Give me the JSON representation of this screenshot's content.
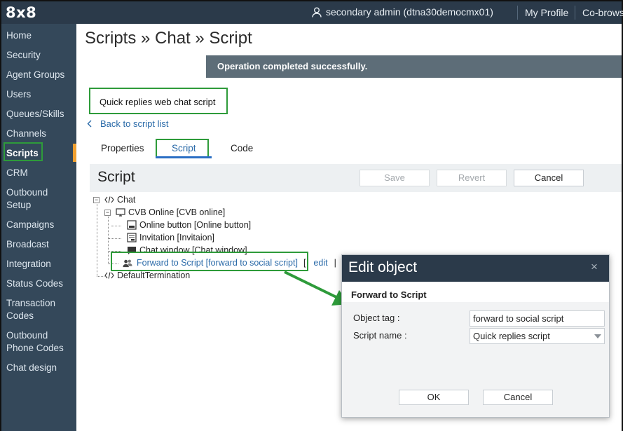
{
  "topbar": {
    "logo": "8x8",
    "user": "secondary admin (dtna30democmx01)",
    "my_profile": "My Profile",
    "cobrowse": "Co-brows"
  },
  "sidebar": {
    "items": [
      {
        "label": "Home"
      },
      {
        "label": "Security"
      },
      {
        "label": "Agent Groups"
      },
      {
        "label": "Users"
      },
      {
        "label": "Queues/Skills"
      },
      {
        "label": "Channels"
      },
      {
        "label": "Scripts",
        "active": true
      },
      {
        "label": "CRM"
      },
      {
        "label": "Outbound"
      },
      {
        "label": "Setup"
      },
      {
        "label": "Campaigns"
      },
      {
        "label": "Broadcast"
      },
      {
        "label": "Integration"
      },
      {
        "label": "Status Codes"
      },
      {
        "label": "Transaction"
      },
      {
        "label": "Codes"
      },
      {
        "label": "Outbound"
      },
      {
        "label": "Phone Codes"
      },
      {
        "label": "Chat design"
      }
    ]
  },
  "page": {
    "title": "Scripts » Chat » Script",
    "toast": "Operation completed successfully.",
    "script_name": "Quick replies web chat script",
    "back_link": "Back to script list",
    "tabs": [
      "Properties",
      "Script",
      "Code"
    ],
    "active_tab": "Script"
  },
  "script_panel": {
    "title": "Script",
    "save": "Save",
    "revert": "Revert",
    "cancel": "Cancel"
  },
  "tree": {
    "chat": "Chat",
    "cvb": "CVB Online [CVB online]",
    "online_button": "Online button [Online button]",
    "invitation": "Invitation [Invitaion]",
    "chat_window": "Chat window [Chat window]",
    "forward": "Forward to Script [forward to social script]",
    "bracket_open": "[",
    "edit": "edit",
    "pipe": "|",
    "default_termination": "DefaultTermination"
  },
  "dialog": {
    "title": "Edit object",
    "close": "×",
    "subtitle": "Forward to Script",
    "object_tag_label": "Object tag :",
    "object_tag_value": "forward to social script",
    "script_name_label": "Script name :",
    "script_name_value": "Quick replies script",
    "ok": "OK",
    "cancel": "Cancel"
  },
  "colors": {
    "topbar": "#2b3a4a",
    "sidebar": "#34485a",
    "highlight_green": "#2e9b3a",
    "link_blue": "#2a6aa8",
    "tab_underline": "#2a6ec4",
    "active_marker": "#f0a030",
    "toast_bg": "#5d6d78"
  }
}
